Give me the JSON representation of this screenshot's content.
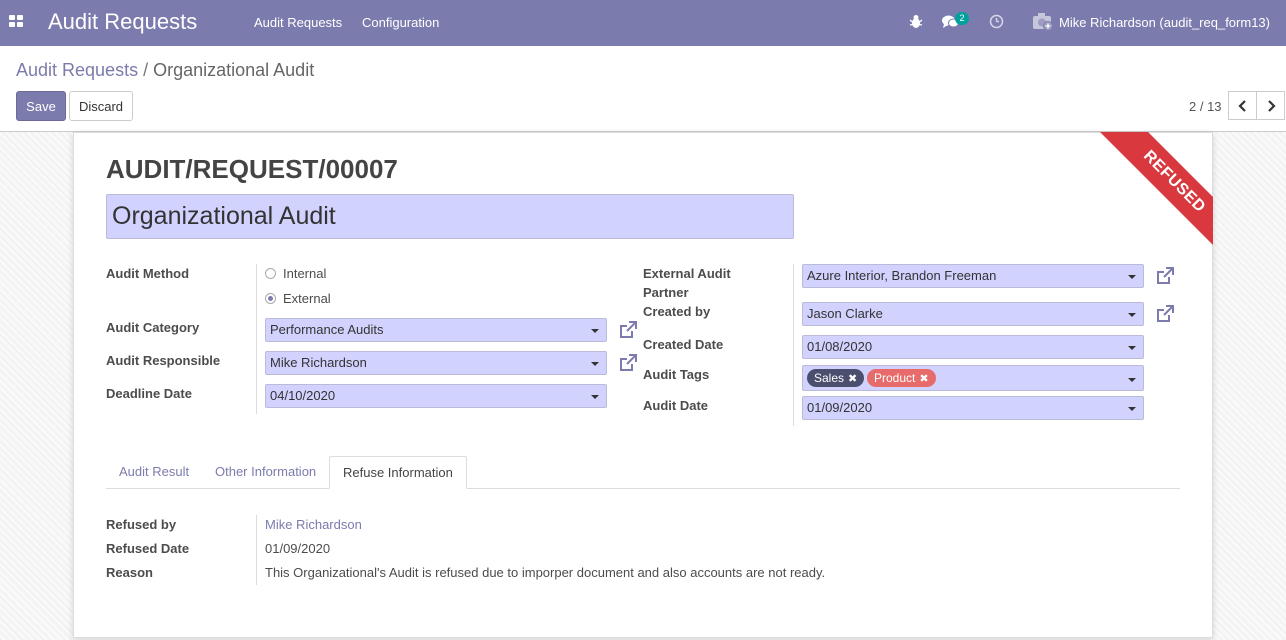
{
  "navbar": {
    "app_title": "Audit Requests",
    "menu": [
      "Audit Requests",
      "Configuration"
    ],
    "messages_count": "2",
    "user": "Mike Richardson (audit_req_form13)",
    "bg_color": "#7c7bad"
  },
  "breadcrumb": {
    "parent": "Audit Requests",
    "separator": "/",
    "current": "Organizational Audit"
  },
  "buttons": {
    "save": "Save",
    "discard": "Discard"
  },
  "pager": {
    "value": "2 / 13"
  },
  "form": {
    "reference": "AUDIT/REQUEST/00007",
    "name": "Organizational Audit",
    "status_ribbon": "REFUSED",
    "left": {
      "audit_method_label": "Audit Method",
      "audit_method_options": [
        "Internal",
        "External"
      ],
      "audit_method_selected": "External",
      "audit_category_label": "Audit Category",
      "audit_category": "Performance Audits",
      "audit_responsible_label": "Audit Responsible",
      "audit_responsible": "Mike Richardson",
      "deadline_label": "Deadline Date",
      "deadline": "04/10/2020"
    },
    "right": {
      "external_partner_label_1": "External Audit",
      "external_partner_label_2": "Partner",
      "external_partner": "Azure Interior, Brandon Freeman",
      "created_by_label": "Created by",
      "created_by": "Jason Clarke",
      "created_date_label": "Created Date",
      "created_date": "01/08/2020",
      "tags_label": "Audit Tags",
      "tags": [
        {
          "name": "Sales",
          "color": "#4a4f6e"
        },
        {
          "name": "Product",
          "color": "#e86b6b"
        }
      ],
      "audit_date_label": "Audit Date",
      "audit_date": "01/09/2020"
    },
    "tabs": [
      "Audit Result",
      "Other Information",
      "Refuse Information"
    ],
    "active_tab": "Refuse Information",
    "refuse": {
      "refused_by_label": "Refused by",
      "refused_by": "Mike Richardson",
      "refused_date_label": "Refused Date",
      "refused_date": "01/09/2020",
      "reason_label": "Reason",
      "reason": "This Organizational's Audit is refused due to imporper document and also accounts are not ready."
    }
  }
}
